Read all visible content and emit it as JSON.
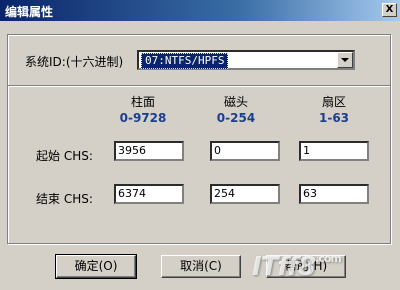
{
  "window": {
    "title": "编辑属性",
    "close_glyph": "X"
  },
  "system_id": {
    "label": "系统ID:(十六进制)",
    "selected_value": "07:NTFS/HPFS"
  },
  "columns": [
    {
      "header": "柱面",
      "range": "0-9728"
    },
    {
      "header": "磁头",
      "range": "0-254"
    },
    {
      "header": "扇区",
      "range": "1-63"
    }
  ],
  "rows": [
    {
      "label": "起始 CHS:",
      "values": [
        "3956",
        "0",
        "1"
      ]
    },
    {
      "label": "结束 CHS:",
      "values": [
        "6374",
        "254",
        "63"
      ]
    }
  ],
  "buttons": {
    "ok": "确定(O)",
    "cancel": "取消(C)",
    "help": "帮助(H)"
  },
  "watermark": {
    "text": "ITﬀ8",
    "suffix": ".com"
  },
  "colors": {
    "title_start": "#0a246a",
    "range_text": "#1a3f8f",
    "dialog_bg": "#d4d0c8"
  }
}
